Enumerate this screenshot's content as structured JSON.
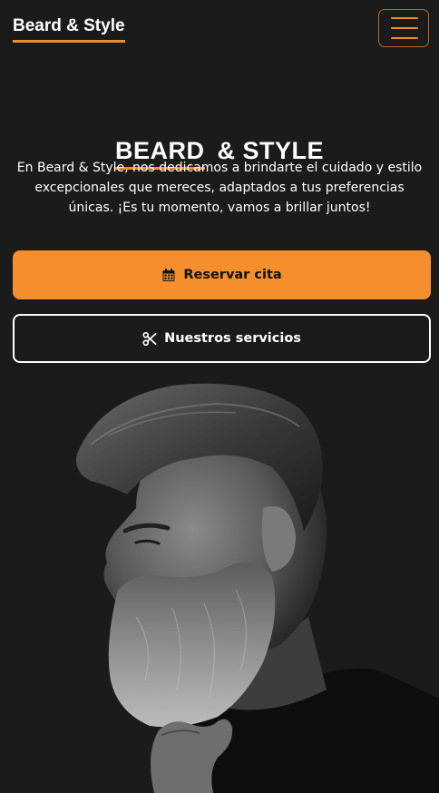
{
  "header": {
    "brand": "Beard & Style",
    "menu_icon": "hamburger-icon",
    "accent_color": "#f28c28"
  },
  "hero": {
    "title_part1": "BEARD",
    "title_part2": "& STYLE",
    "description": "En Beard & Style, nos dedicamos a brindarte el cuidado y estilo excepcionales que mereces, adaptados a tus preferencias únicas. ¡Es tu momento, vamos a brillar juntos!",
    "primary_button": {
      "label": "Reservar cita",
      "icon": "calendar-icon"
    },
    "secondary_button": {
      "label": "Nuestros servicios",
      "icon": "scissors-icon"
    },
    "image": "bearded-man-portrait"
  },
  "colors": {
    "background": "#1b1b1b",
    "accent": "#f58f2d",
    "text": "#ffffff"
  }
}
